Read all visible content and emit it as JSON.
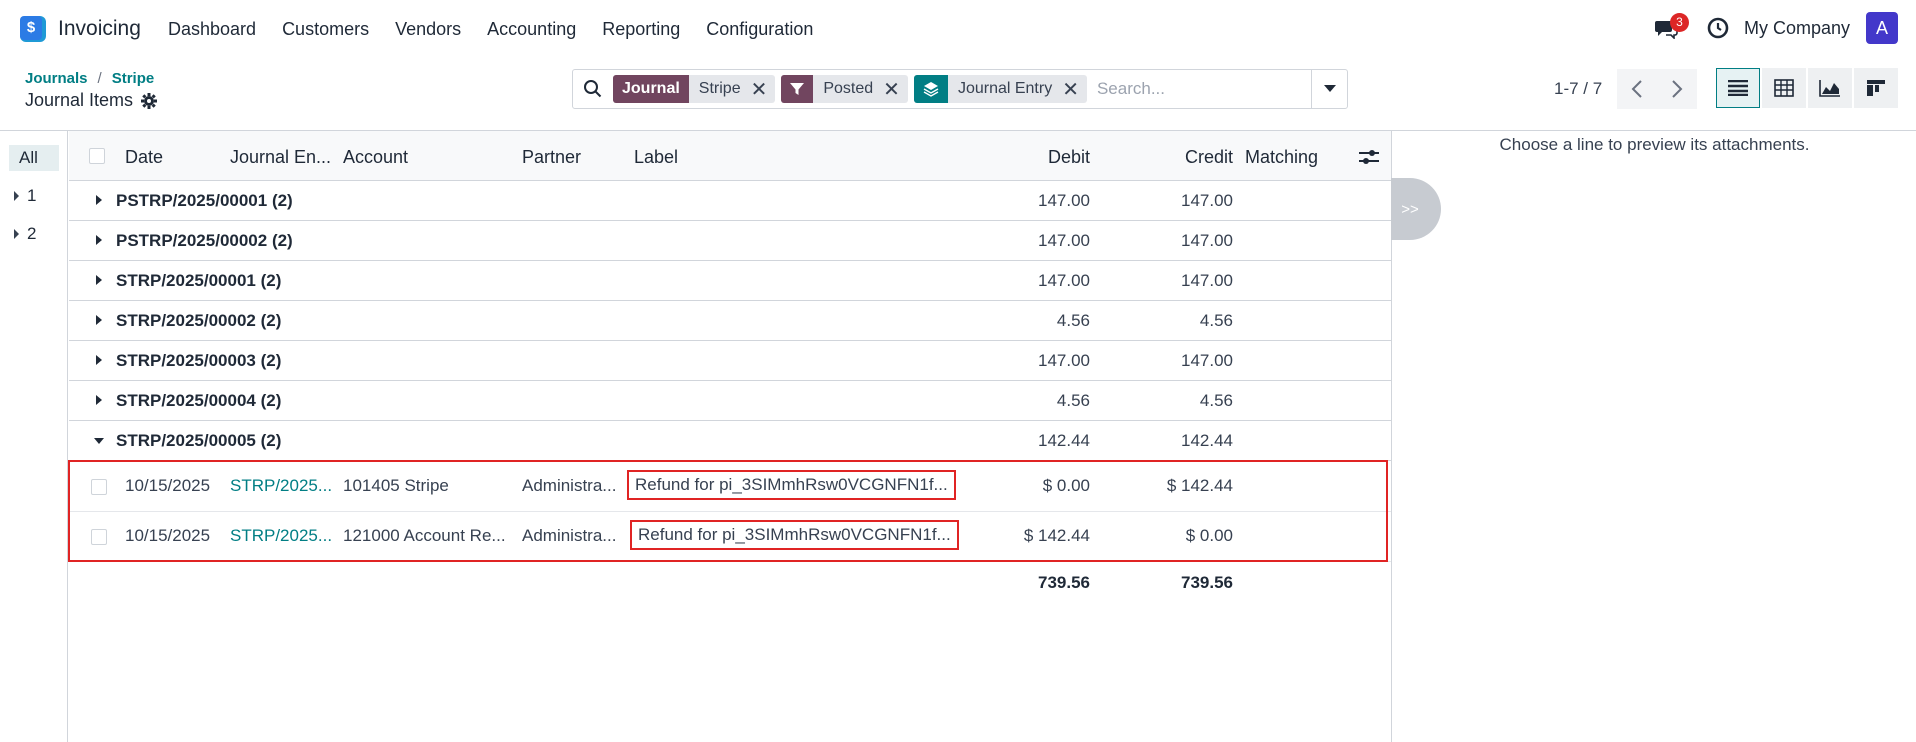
{
  "navbar": {
    "app_name": "Invoicing",
    "menu": [
      "Dashboard",
      "Customers",
      "Vendors",
      "Accounting",
      "Reporting",
      "Configuration"
    ],
    "chat_badge": "3",
    "company": "My Company",
    "avatar": "A"
  },
  "breadcrumb": {
    "root": "Journals",
    "separator": "/",
    "current": "Stripe"
  },
  "page_title": "Journal Items",
  "search": {
    "facets": [
      {
        "tag": "Journal",
        "value": "Stripe",
        "icon": "text-tag"
      },
      {
        "tag": "filter-icon",
        "value": "Posted",
        "icon": "filter-icon",
        "color": "#71455f"
      },
      {
        "tag": "layers-icon",
        "value": "Journal Entry",
        "icon": "layers-icon",
        "color": "#017e84"
      }
    ],
    "placeholder": "Search..."
  },
  "pager": {
    "text": "1-7 / 7"
  },
  "left_panel": {
    "items": [
      "All",
      "1",
      "2"
    ]
  },
  "table": {
    "headers": {
      "date": "Date",
      "journal_entry": "Journal En...",
      "account": "Account",
      "partner": "Partner",
      "label": "Label",
      "debit": "Debit",
      "credit": "Credit",
      "matching": "Matching"
    },
    "groups": [
      {
        "name": "PSTRP/2025/00001 (2)",
        "debit": "147.00",
        "credit": "147.00"
      },
      {
        "name": "PSTRP/2025/00002 (2)",
        "debit": "147.00",
        "credit": "147.00"
      },
      {
        "name": "STRP/2025/00001 (2)",
        "debit": "147.00",
        "credit": "147.00"
      },
      {
        "name": "STRP/2025/00002 (2)",
        "debit": "4.56",
        "credit": "4.56"
      },
      {
        "name": "STRP/2025/00003 (2)",
        "debit": "147.00",
        "credit": "147.00"
      },
      {
        "name": "STRP/2025/00004 (2)",
        "debit": "4.56",
        "credit": "4.56"
      },
      {
        "name": "STRP/2025/00005 (2)",
        "debit": "142.44",
        "credit": "142.44"
      }
    ],
    "rows": [
      {
        "date": "10/15/2025",
        "journal_entry": "STRP/2025...",
        "account": "101405 Stripe",
        "partner": "Administra...",
        "label": "Refund for pi_3SIMmhRsw0VCGNFN1f...",
        "debit": "$ 0.00",
        "credit": "$ 142.44"
      },
      {
        "date": "10/15/2025",
        "journal_entry": "STRP/2025...",
        "account": "121000 Account Re...",
        "partner": "Administra...",
        "label": "Refund for pi_3SIMmhRsw0VCGNFN1f...",
        "debit": "$ 142.44",
        "credit": "$ 0.00"
      }
    ],
    "totals": {
      "debit": "739.56",
      "credit": "739.56"
    }
  },
  "preview": {
    "text": "Choose a line to preview its attachments.",
    "collapse_label": ">>"
  },
  "colors": {
    "accent": "#017e84",
    "journal_tag": "#71455f",
    "highlight": "#e02424",
    "avatar": "#4338ca"
  }
}
